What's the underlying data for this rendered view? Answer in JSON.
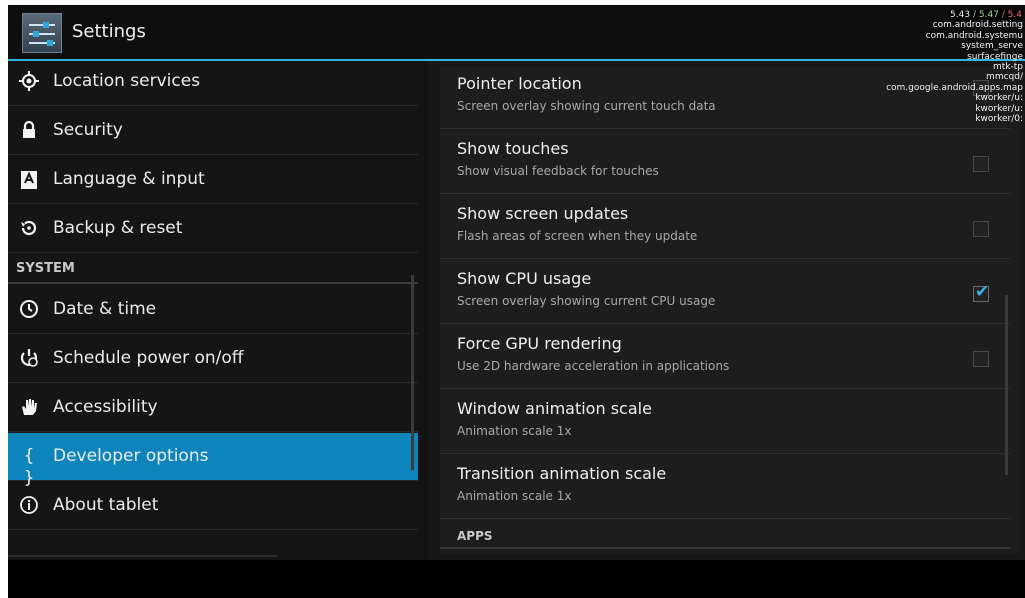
{
  "app": {
    "title": "Settings"
  },
  "left_pane": {
    "items_top": [
      {
        "label": "Location services",
        "icon": "location-icon"
      },
      {
        "label": "Security",
        "icon": "lock-icon"
      },
      {
        "label": "Language & input",
        "icon": "keyboard-a-icon"
      },
      {
        "label": "Backup & reset",
        "icon": "restore-icon"
      }
    ],
    "section_system": "SYSTEM",
    "items_system": [
      {
        "label": "Date & time",
        "icon": "clock-icon"
      },
      {
        "label": "Schedule power on/off",
        "icon": "power-schedule-icon"
      },
      {
        "label": "Accessibility",
        "icon": "hand-icon"
      },
      {
        "label": "Developer options",
        "icon": "braces-icon",
        "selected": true
      },
      {
        "label": "About tablet",
        "icon": "info-icon"
      }
    ]
  },
  "right_pane": {
    "rows": [
      {
        "title": "Pointer location",
        "summary": "Screen overlay showing current touch data",
        "checkbox": true,
        "checked": false
      },
      {
        "title": "Show touches",
        "summary": "Show visual feedback for touches",
        "checkbox": true,
        "checked": false
      },
      {
        "title": "Show screen updates",
        "summary": "Flash areas of screen when they update",
        "checkbox": true,
        "checked": false
      },
      {
        "title": "Show CPU usage",
        "summary": "Screen overlay showing current CPU usage",
        "checkbox": true,
        "checked": true
      },
      {
        "title": "Force GPU rendering",
        "summary": "Use 2D hardware acceleration in applications",
        "checkbox": true,
        "checked": false
      },
      {
        "title": "Window animation scale",
        "summary": "Animation scale 1x",
        "checkbox": false
      },
      {
        "title": "Transition animation scale",
        "summary": "Animation scale 1x",
        "checkbox": false
      }
    ],
    "section_apps": "APPS"
  },
  "cpu_overlay": {
    "loads": [
      "5.43",
      "5.47",
      "5.4"
    ],
    "processes": [
      "com.android.setting",
      "com.android.systemu",
      "system_serve",
      "surfacefinge",
      "mtk-tp",
      "mmcqd/",
      "com.google.android.apps.map",
      "kworker/u:",
      "kworker/u:",
      "kworker/0:"
    ]
  },
  "colors": {
    "accent": "#33b5e5",
    "selected_bg": "#0e84bd",
    "background": "#151515"
  }
}
